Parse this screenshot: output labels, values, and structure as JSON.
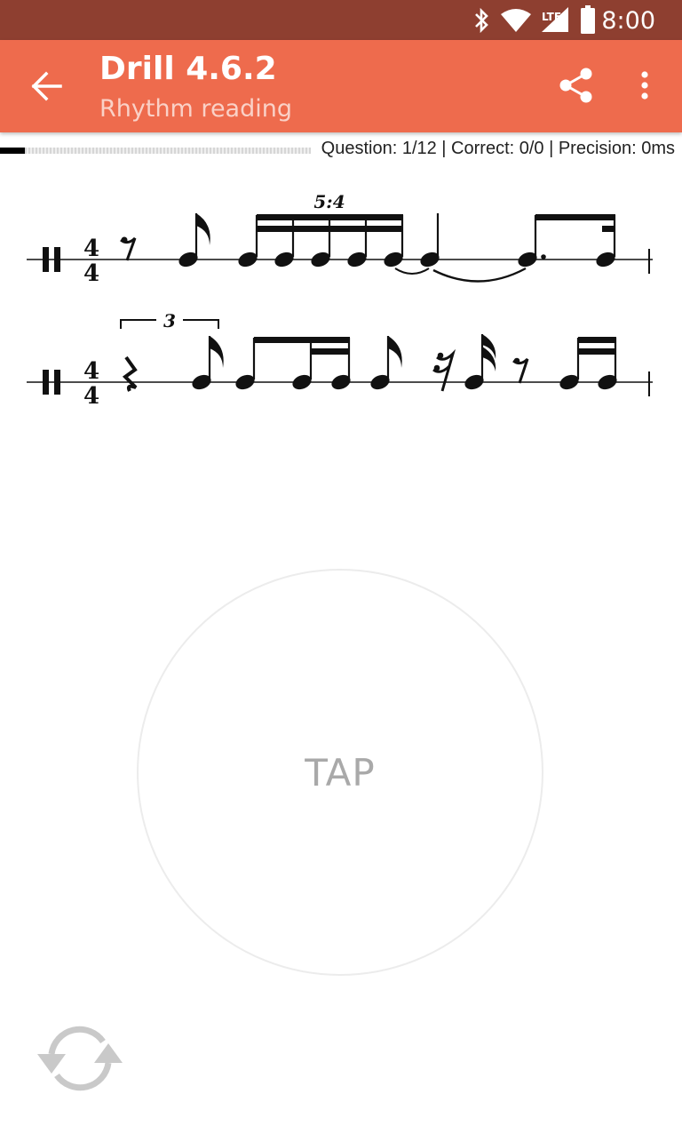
{
  "status_bar": {
    "time": "8:00",
    "network_label": "LTE",
    "icons": [
      "bluetooth-icon",
      "wifi-icon",
      "lte-signal-icon",
      "battery-icon"
    ]
  },
  "app_bar": {
    "title": "Drill 4.6.2",
    "subtitle": "Rhythm reading",
    "back_icon": "arrow-left-icon",
    "share_icon": "share-icon",
    "menu_icon": "more-vert-icon"
  },
  "progress": {
    "fraction": 0.08,
    "stats_text": "Question: 1/12 | Correct: 0/0 | Precision: 0ms"
  },
  "score": {
    "time_signature": {
      "top": "4",
      "bottom": "4"
    },
    "staff_1": {
      "tuplet_label": "5:4"
    },
    "staff_2": {
      "tuplet_label": "3"
    }
  },
  "tap": {
    "label": "TAP"
  },
  "refresh_icon": "refresh-icon",
  "colors": {
    "status_bar": "#8e3f30",
    "app_bar": "#ee6b4d",
    "subtitle": "#fad1c7",
    "tap_text": "#a9a9a9"
  }
}
